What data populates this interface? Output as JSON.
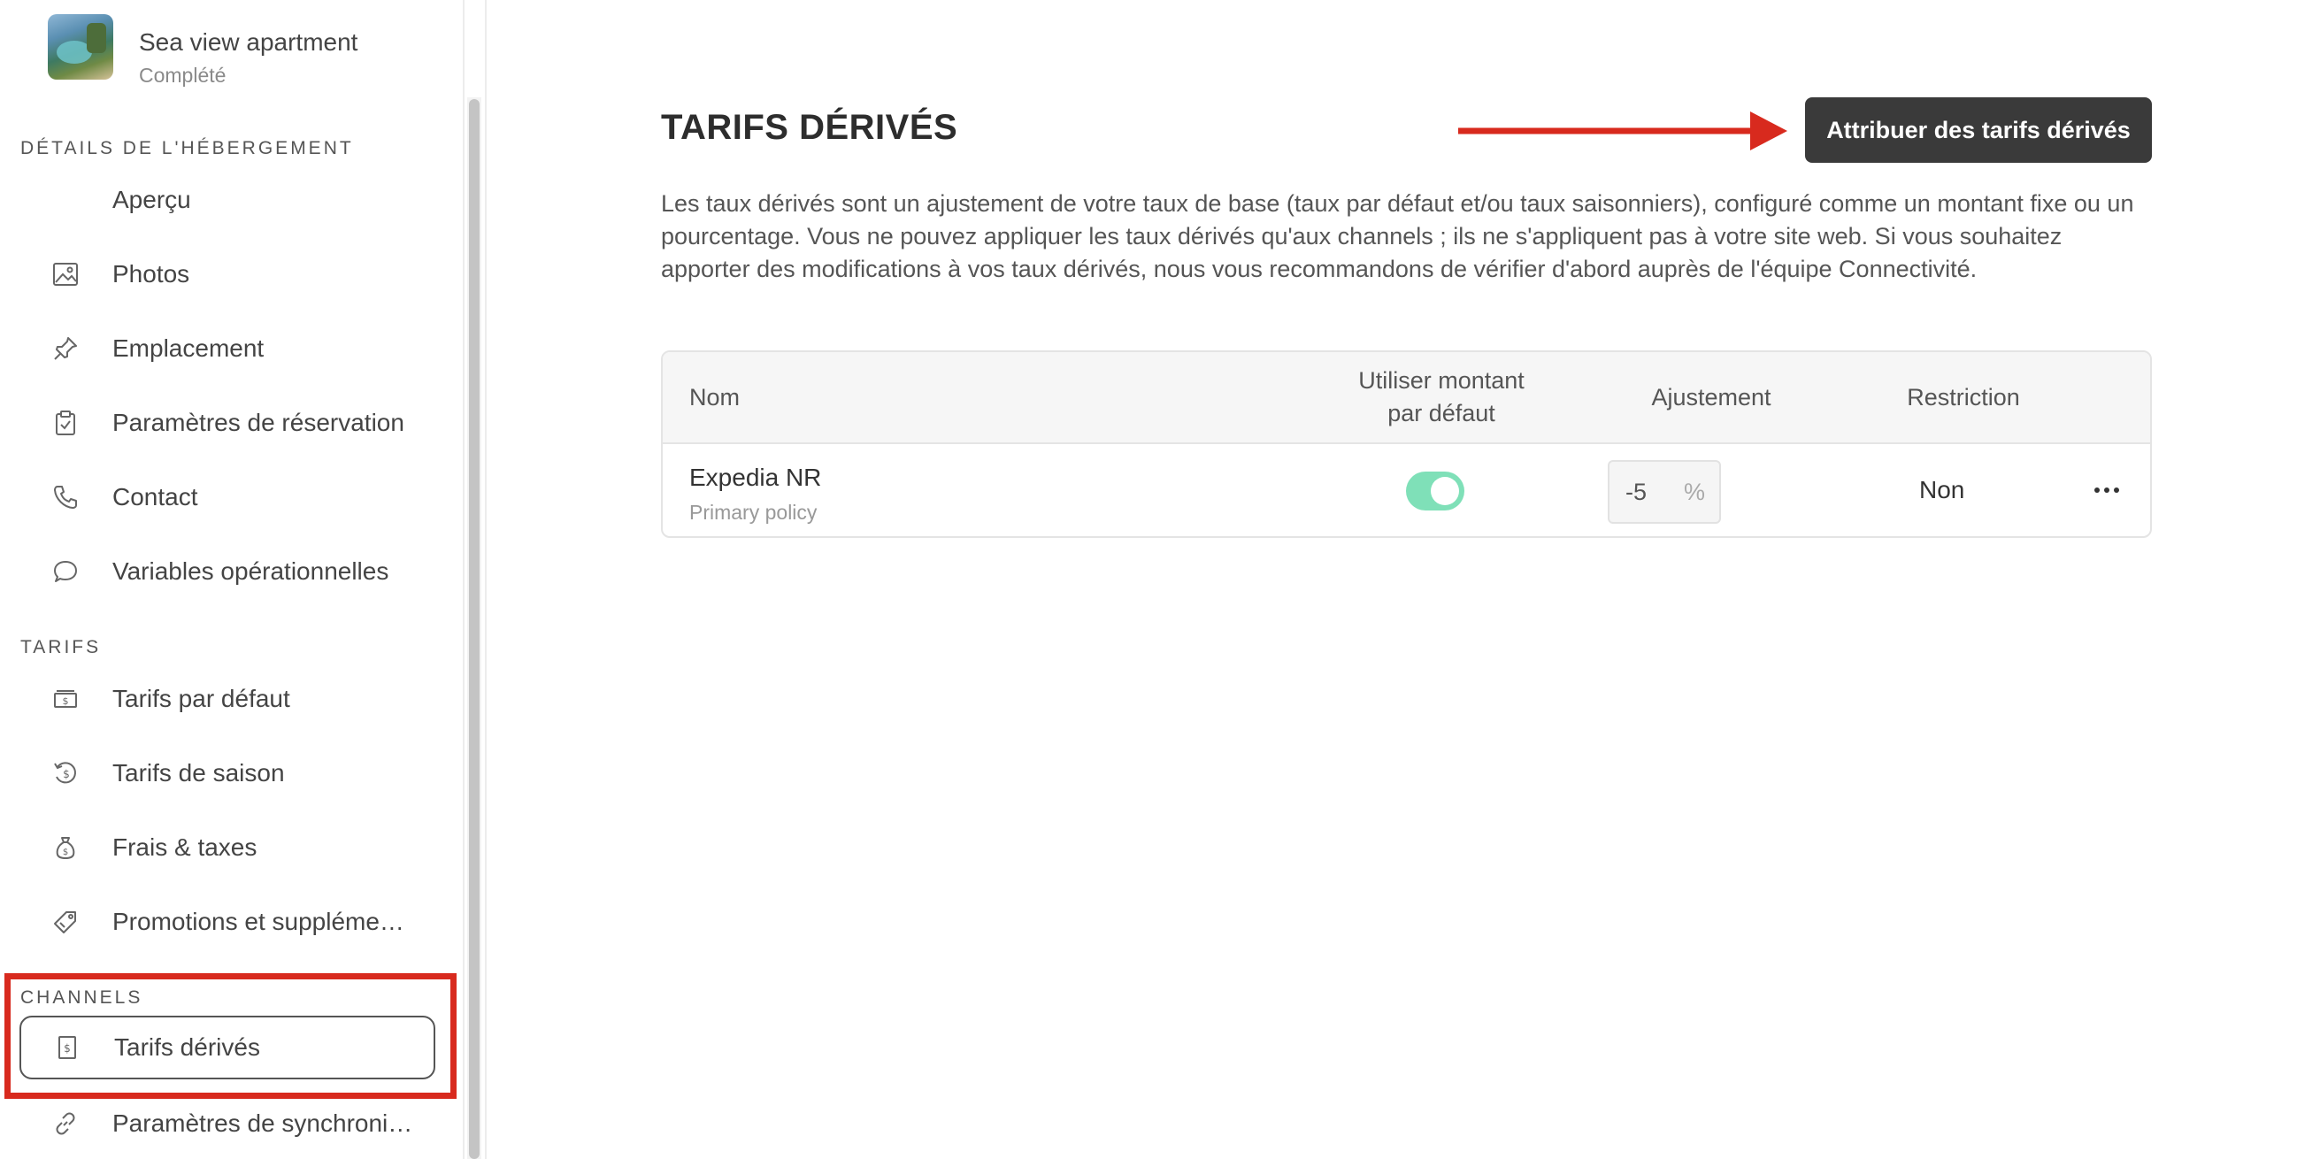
{
  "property": {
    "name": "Sea view apartment",
    "status": "Complété"
  },
  "sidebar": {
    "sections": [
      {
        "title": "DÉTAILS DE L'HÉBERGEMENT",
        "items": [
          {
            "label": "Aperçu",
            "icon": "none"
          },
          {
            "label": "Photos",
            "icon": "image-icon"
          },
          {
            "label": "Emplacement",
            "icon": "pin-icon"
          },
          {
            "label": "Paramètres de réservation",
            "icon": "clipboard-check-icon"
          },
          {
            "label": "Contact",
            "icon": "phone-icon"
          },
          {
            "label": "Variables opérationnelles",
            "icon": "chat-bubble-icon"
          }
        ]
      },
      {
        "title": "TARIFS",
        "items": [
          {
            "label": "Tarifs par défaut",
            "icon": "cash-icon"
          },
          {
            "label": "Tarifs de saison",
            "icon": "dollar-refresh-icon"
          },
          {
            "label": "Frais & taxes",
            "icon": "money-bag-icon"
          },
          {
            "label": "Promotions et suppléme…",
            "icon": "tag-icon"
          }
        ]
      },
      {
        "title": "CHANNELS",
        "items": [
          {
            "label": "Tarifs dérivés",
            "icon": "dollar-document-icon",
            "active": true
          },
          {
            "label": "Paramètres de synchroni…",
            "icon": "link-icon"
          }
        ]
      }
    ]
  },
  "main": {
    "title": "TARIFS DÉRIVÉS",
    "assign_button": "Attribuer des tarifs dérivés",
    "description": "Les taux dérivés sont un ajustement de votre taux de base (taux par défaut et/ou taux saisonniers), configuré comme un montant fixe ou un pourcentage. Vous ne pouvez appliquer les taux dérivés qu'aux channels ; ils ne s'appliquent pas à votre site web. Si vous souhaitez apporter des modifications à vos taux dérivés, nous vous recommandons de vérifier d'abord auprès de l'équipe Connectivité.",
    "table": {
      "headers": {
        "name": "Nom",
        "default_amount": "Utiliser montant par défaut",
        "adjustment": "Ajustement",
        "restriction": "Restriction"
      },
      "rows": [
        {
          "name": "Expedia NR",
          "policy": "Primary policy",
          "use_default": true,
          "adjustment_value": "-5",
          "adjustment_unit": "%",
          "restriction": "Non"
        }
      ]
    }
  },
  "colors": {
    "annotation_red": "#d82a1e",
    "toggle_on": "#7fe0b8",
    "button_dark": "#3a3a3a"
  }
}
